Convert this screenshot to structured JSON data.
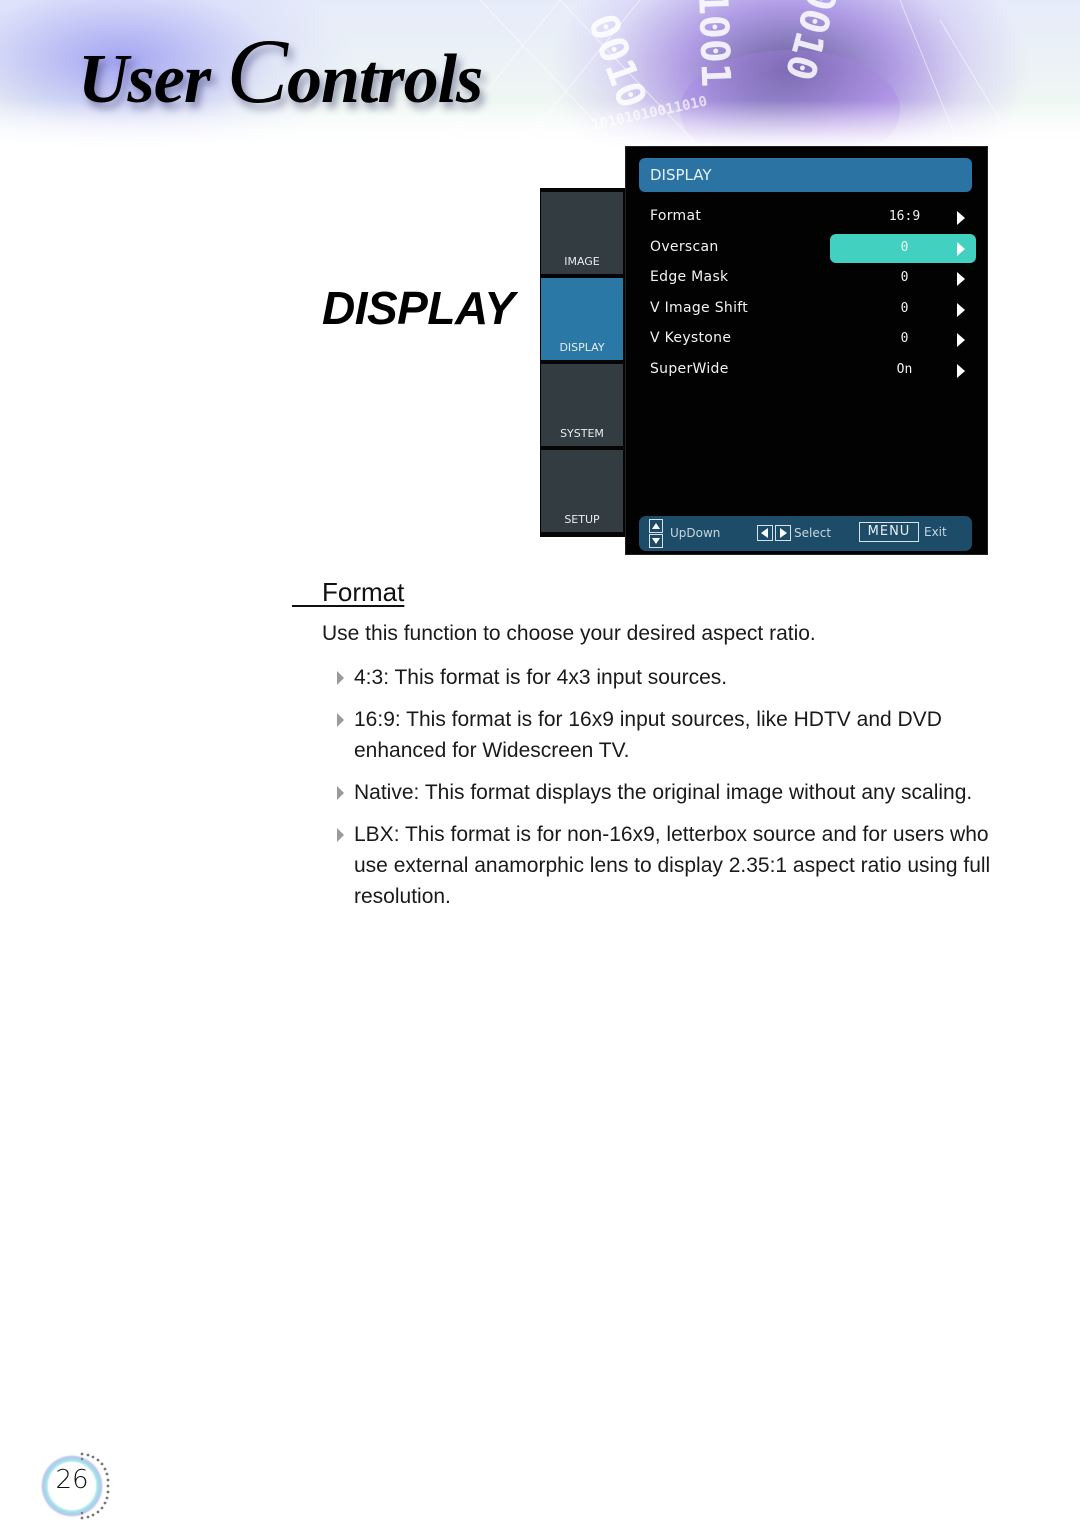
{
  "header": {
    "title_first_word": "User",
    "title_second_cap": "C",
    "title_second_rest": "ontrols"
  },
  "section": {
    "heading": "DISPLAY"
  },
  "osd_menu": {
    "side_tabs": [
      {
        "label": "IMAGE",
        "active": false
      },
      {
        "label": "DISPLAY",
        "active": true
      },
      {
        "label": "SYSTEM",
        "active": false
      },
      {
        "label": "SETUP",
        "active": false
      }
    ],
    "title": "DISPLAY",
    "items": [
      {
        "label": "Format",
        "value": "16:9",
        "selected": false
      },
      {
        "label": "Overscan",
        "value": "0",
        "selected": true
      },
      {
        "label": "Edge Mask",
        "value": "0",
        "selected": false
      },
      {
        "label": "V Image Shift",
        "value": "0",
        "selected": false
      },
      {
        "label": "V Keystone",
        "value": "0",
        "selected": false
      },
      {
        "label": "SuperWide",
        "value": "On",
        "selected": false
      }
    ],
    "footer": {
      "updown_label": "UpDown",
      "select_label": "Select",
      "menu_key": "MENU",
      "exit_label": "Exit"
    },
    "colors": {
      "title_bar": "#2a73a2",
      "highlight": "#42d0c0",
      "active_tab": "#2a78a6",
      "footer": "#1d4c69"
    }
  },
  "content": {
    "subheading": "Format",
    "intro": "Use this function to choose your desired aspect ratio.",
    "bullets": [
      "4:3: This format is for 4x3 input sources.",
      "16:9: This format is for 16x9 input sources, like HDTV and DVD enhanced for Widescreen TV.",
      "Native: This format displays the original image without any scaling.",
      "LBX: This format is for non-16x9, letterbox source and for users who use external anamorphic lens to display 2.35:1 aspect ratio using full resolution."
    ]
  },
  "footer": {
    "page_number": "26"
  },
  "decor": {
    "binary_strings": [
      "0010",
      "1001",
      "0010",
      "10101010011010"
    ]
  }
}
